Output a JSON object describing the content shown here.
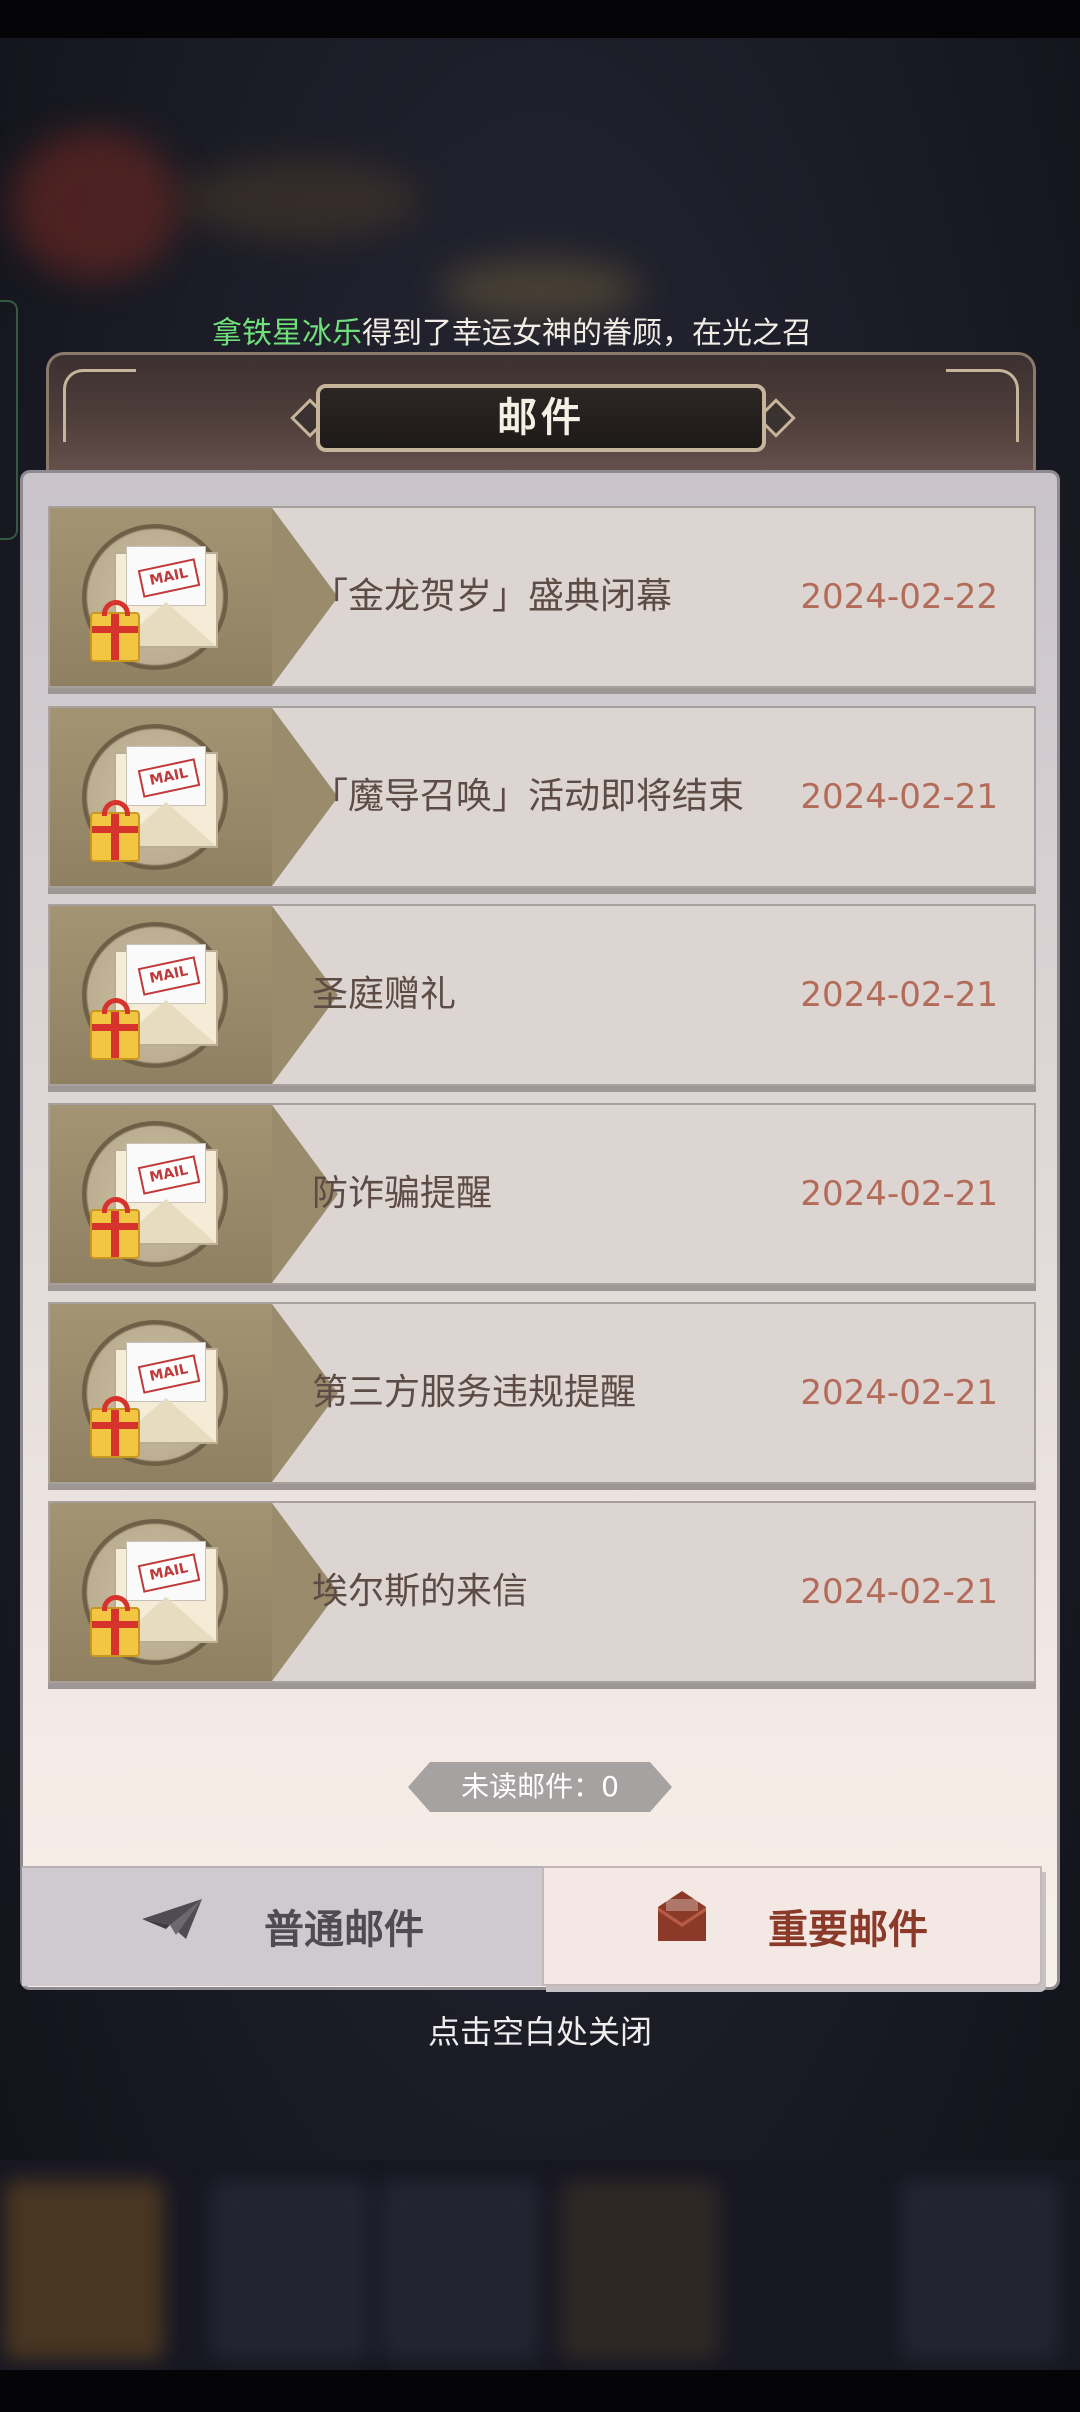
{
  "announcement": {
    "player_name": "拿铁星冰乐",
    "message": "得到了幸运女神的眷顾，在光之召"
  },
  "dialog": {
    "title": "邮件"
  },
  "mails": [
    {
      "title": "「金龙贺岁」盛典闭幕",
      "date": "2024-02-22",
      "icon": "mail-envelope-gift-icon"
    },
    {
      "title": "「魔导召唤」活动即将结束",
      "date": "2024-02-21",
      "icon": "mail-envelope-gift-icon"
    },
    {
      "title": "圣庭赠礼",
      "date": "2024-02-21",
      "icon": "mail-envelope-gift-icon"
    },
    {
      "title": "防诈骗提醒",
      "date": "2024-02-21",
      "icon": "mail-envelope-gift-icon"
    },
    {
      "title": "第三方服务违规提醒",
      "date": "2024-02-21",
      "icon": "mail-envelope-gift-icon"
    },
    {
      "title": "埃尔斯的来信",
      "date": "2024-02-21",
      "icon": "mail-envelope-gift-icon"
    }
  ],
  "stamp_text": "MAIL",
  "unread": {
    "text": "未读邮件：0"
  },
  "tabs": {
    "normal": {
      "label": "普通邮件",
      "icon": "paper-plane-icon"
    },
    "important": {
      "label": "重要邮件",
      "icon": "envelope-icon",
      "selected": true
    }
  },
  "close_hint": "点击空白处关闭",
  "colors": {
    "date": "#b46c5a",
    "title": "#5c4c45",
    "important_tab_text": "#8b3a2a",
    "player_name": "#6fe07a"
  }
}
